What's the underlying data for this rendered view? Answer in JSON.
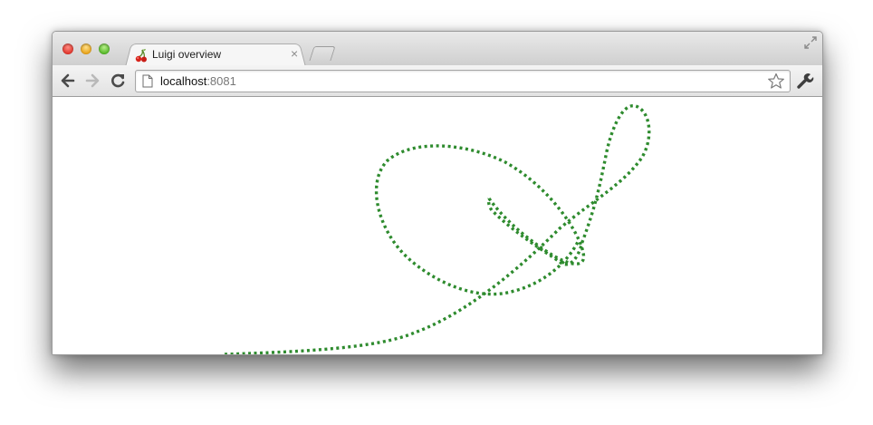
{
  "tab": {
    "title": "Luigi overview",
    "close_glyph": "×",
    "favicon_icon": "cherries-icon"
  },
  "address_bar": {
    "host": "localhost",
    "port": ":8081",
    "page_icon": "document-icon"
  },
  "toolbar": {
    "back_icon": "back-arrow-icon",
    "forward_icon": "forward-arrow-icon",
    "reload_icon": "reload-icon",
    "bookmark_icon": "star-icon",
    "menu_icon": "wrench-icon"
  },
  "colors": {
    "trail": "#2e8b2e",
    "traffic_close": "#e0362c",
    "traffic_minimize": "#e7a218",
    "traffic_maximize": "#55b728"
  }
}
